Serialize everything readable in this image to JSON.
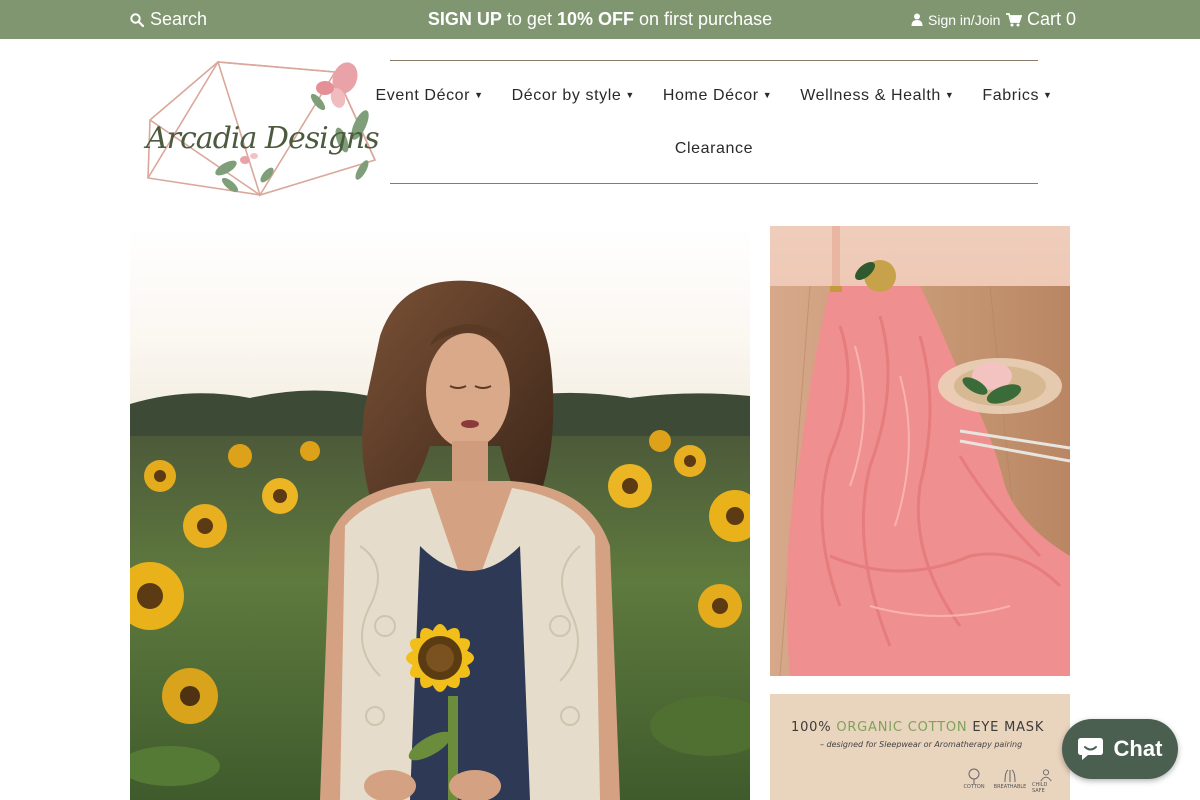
{
  "topbar": {
    "search_label": "Search",
    "promo_prefix": "SIGN UP",
    "promo_middle": "to get",
    "promo_offer": "10% OFF",
    "promo_suffix": "on first purchase",
    "account_label": "Sign in/Join",
    "cart_label": "Cart",
    "cart_count": "0",
    "bg_color": "#7f9670"
  },
  "logo": {
    "text": "Arcadia Designs"
  },
  "nav": {
    "items": [
      {
        "label": "Event Décor"
      },
      {
        "label": "Décor by style"
      },
      {
        "label": "Home Décor"
      },
      {
        "label": "Wellness & Health"
      },
      {
        "label": "Fabrics"
      }
    ],
    "clearance_label": "Clearance"
  },
  "promo_tiles": {
    "eye_mask_headline_prefix": "100%",
    "eye_mask_headline_green": "ORGANIC COTTON",
    "eye_mask_headline_suffix": "EYE MASK",
    "eye_mask_sub": "– designed for Sleepwear or Aromatherapy pairing",
    "badges": [
      "COTTON",
      "BREATHABLE",
      "CHILD SAFE"
    ]
  },
  "chat": {
    "label": "Chat",
    "color": "#4a5f4f"
  }
}
